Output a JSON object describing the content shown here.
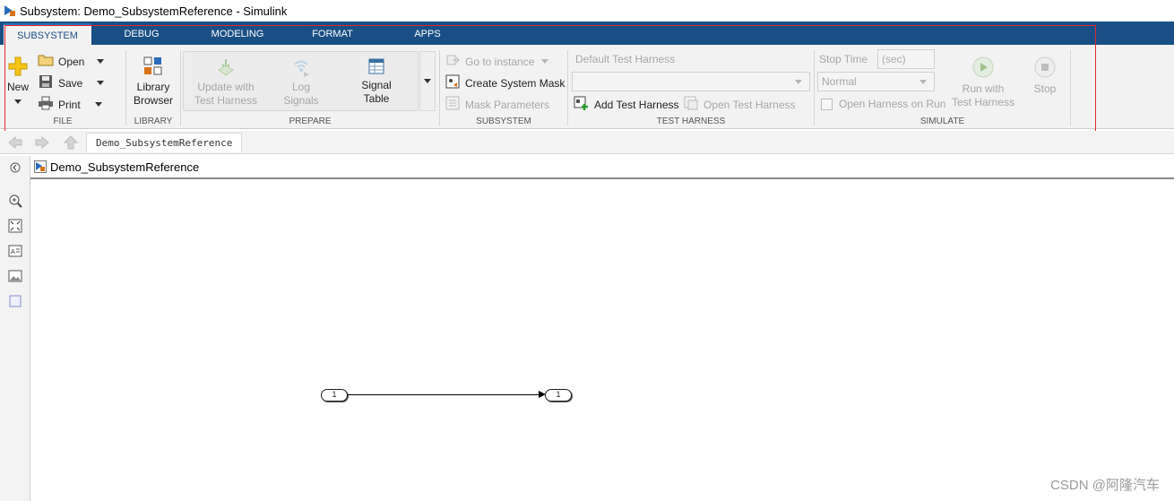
{
  "window": {
    "title": "Subsystem: Demo_SubsystemReference - Simulink"
  },
  "tabs": [
    {
      "label": "SUBSYSTEM",
      "active": true
    },
    {
      "label": "DEBUG"
    },
    {
      "label": "MODELING"
    },
    {
      "label": "FORMAT"
    },
    {
      "label": "APPS"
    }
  ],
  "file": {
    "new_label": "New",
    "open_label": "Open",
    "save_label": "Save",
    "print_label": "Print",
    "group_label": "FILE"
  },
  "library": {
    "browser_line1": "Library",
    "browser_line2": "Browser",
    "group_label": "LIBRARY"
  },
  "prepare": {
    "update_line1": "Update with",
    "update_line2": "Test Harness",
    "log_line1": "Log",
    "log_line2": "Signals",
    "signal_line1": "Signal",
    "signal_line2": "Table",
    "group_label": "PREPARE"
  },
  "subsystem": {
    "go_to_instance": "Go to instance",
    "create_mask": "Create System Mask",
    "mask_params": "Mask Parameters",
    "group_label": "SUBSYSTEM"
  },
  "test_harness": {
    "default_label": "Default Test Harness",
    "add_label": "Add Test Harness",
    "open_label": "Open Test Harness",
    "group_label": "TEST HARNESS"
  },
  "simulate": {
    "stop_time_label": "Stop Time",
    "stop_time_placeholder": "(sec)",
    "mode_value": "Normal",
    "open_harness_on_run": "Open Harness on Run",
    "run_line1": "Run with",
    "run_line2": "Test Harness",
    "stop_label": "Stop",
    "group_label": "SIMULATE"
  },
  "breadcrumb": {
    "tab_label": "Demo_SubsystemReference"
  },
  "address": {
    "model_name": "Demo_SubsystemReference"
  },
  "canvas": {
    "inport_label": "1",
    "outport_label": "1"
  },
  "watermark": "CSDN @阿隆汽车",
  "colors": {
    "tab_bar": "#1a4f86",
    "highlight": "#e0262e",
    "ribbon_bg": "#f2f2f2"
  }
}
